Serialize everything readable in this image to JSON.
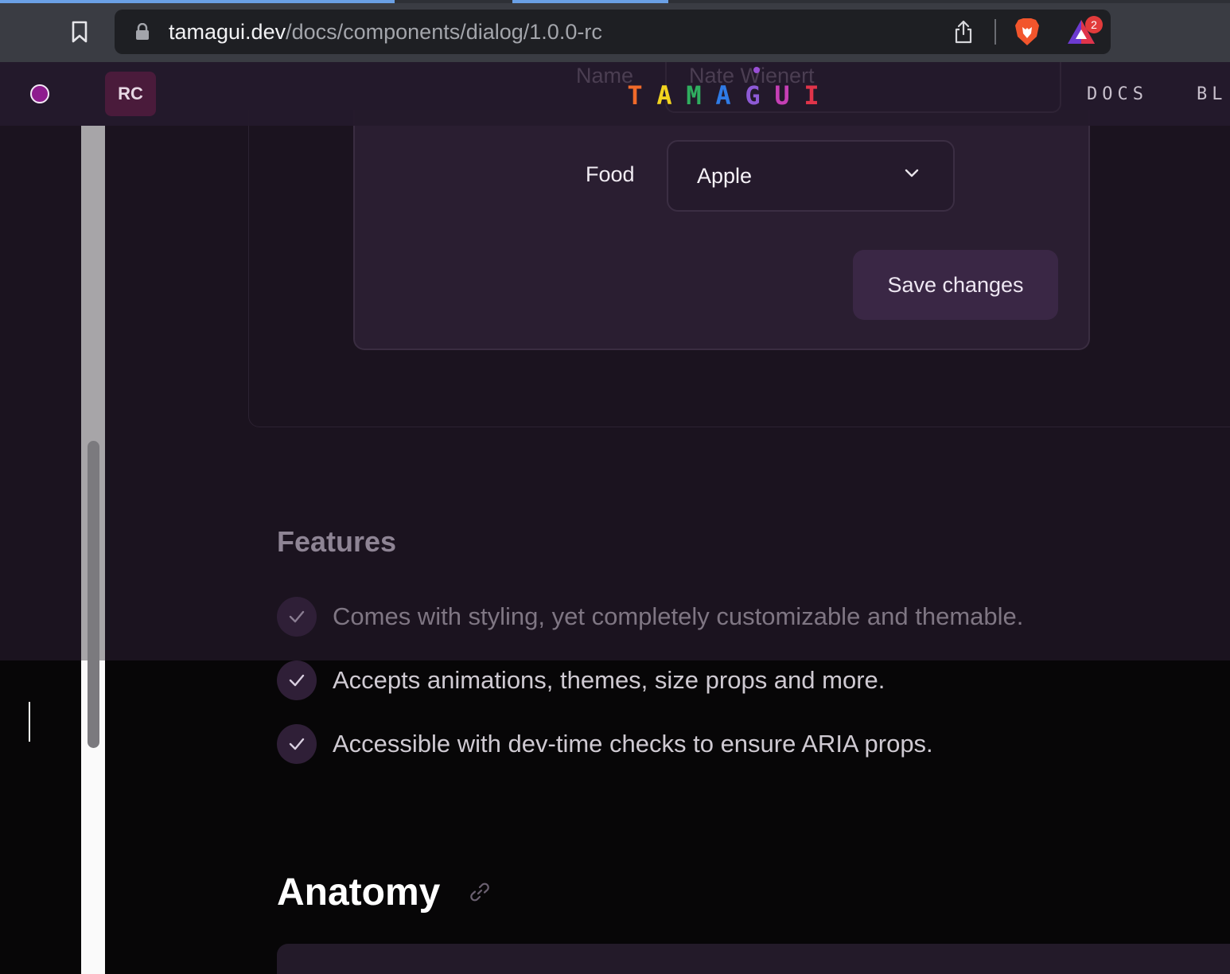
{
  "browser": {
    "url_host": "tamagui.dev",
    "url_path": "/docs/components/dialog/1.0.0-rc",
    "notification_count": "2"
  },
  "header": {
    "version_badge": "RC",
    "logo_letters": [
      "T",
      "A",
      "M",
      "A",
      "G",
      "U",
      "I"
    ],
    "logo_colors": [
      "#f06a2a",
      "#f2d41f",
      "#2fae5f",
      "#2f7be6",
      "#8e5ad6",
      "#c63fb5",
      "#e0344a"
    ],
    "nav_docs": "DOCS",
    "nav_blog": "BL"
  },
  "dialog": {
    "name_label": "Name",
    "name_value": "Nate Wienert",
    "food_label": "Food",
    "food_value": "Apple",
    "save_label": "Save changes"
  },
  "features": {
    "title": "Features",
    "items": [
      "Comes with styling, yet completely customizable and themable.",
      "Accepts animations, themes, size props and more.",
      "Accessible with dev-time checks to ensure ARIA props."
    ]
  },
  "anatomy": {
    "title": "Anatomy"
  },
  "colors": {
    "accent": "#8e1d8e",
    "dialog_bg": "#2a1e31",
    "page_bg": "#070607"
  }
}
